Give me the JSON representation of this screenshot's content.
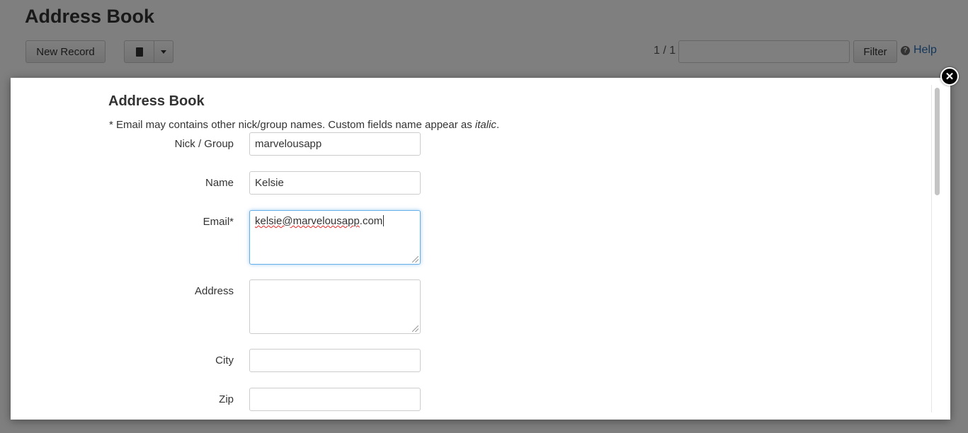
{
  "page": {
    "title": "Address Book",
    "toolbar": {
      "new_record_label": "New Record",
      "book_icon": "book-icon",
      "caret_icon": "caret-down-icon",
      "pager": "1 / 1",
      "filter_value": "",
      "filter_label": "Filter",
      "help_label": "Help",
      "help_icon": "question-circle-icon"
    }
  },
  "modal": {
    "title": "Address Book",
    "note_prefix": "* Email may contains other nick/group names. Custom fields name appear as ",
    "note_italic": "italic",
    "note_suffix": ".",
    "close_icon": "close-icon",
    "fields": {
      "nick": {
        "label": "Nick / Group",
        "value": "marvelousapp"
      },
      "name": {
        "label": "Name",
        "value": "Kelsie"
      },
      "email": {
        "label": "Email*",
        "value_misspelled": "kelsie@marvelousapp",
        "value_rest": ".com"
      },
      "address": {
        "label": "Address",
        "value": ""
      },
      "city": {
        "label": "City",
        "value": ""
      },
      "zip": {
        "label": "Zip",
        "value": ""
      }
    }
  },
  "colors": {
    "link": "#2a6fb5",
    "focus": "#66afe9",
    "overlay": "rgba(0,0,0,0.5)"
  }
}
